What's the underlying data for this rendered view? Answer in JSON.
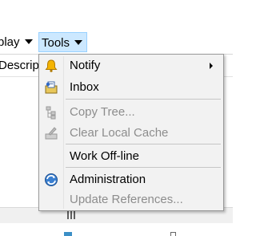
{
  "menubar": {
    "display_label": "play",
    "tools_label": "Tools"
  },
  "list_header": {
    "description_label": "Descrip"
  },
  "tools_menu": {
    "items": [
      {
        "label": "Notify",
        "icon": "bell-icon",
        "enabled": true,
        "has_submenu": true
      },
      {
        "label": "Inbox",
        "icon": "inbox-icon",
        "enabled": true
      },
      {
        "label": "Copy Tree...",
        "icon": "copy-tree-icon",
        "enabled": false
      },
      {
        "label": "Clear Local Cache",
        "icon": "clear-cache-icon",
        "enabled": false
      },
      {
        "label": "Work Off-line",
        "enabled": true
      },
      {
        "label": "Administration",
        "icon": "administration-icon",
        "enabled": true
      },
      {
        "label": "Update References...",
        "enabled": false
      }
    ]
  },
  "colors": {
    "menu_highlight": "#cce8ff",
    "menu_highlight_border": "#99d1ff",
    "disabled_text": "#8d8d8d"
  }
}
